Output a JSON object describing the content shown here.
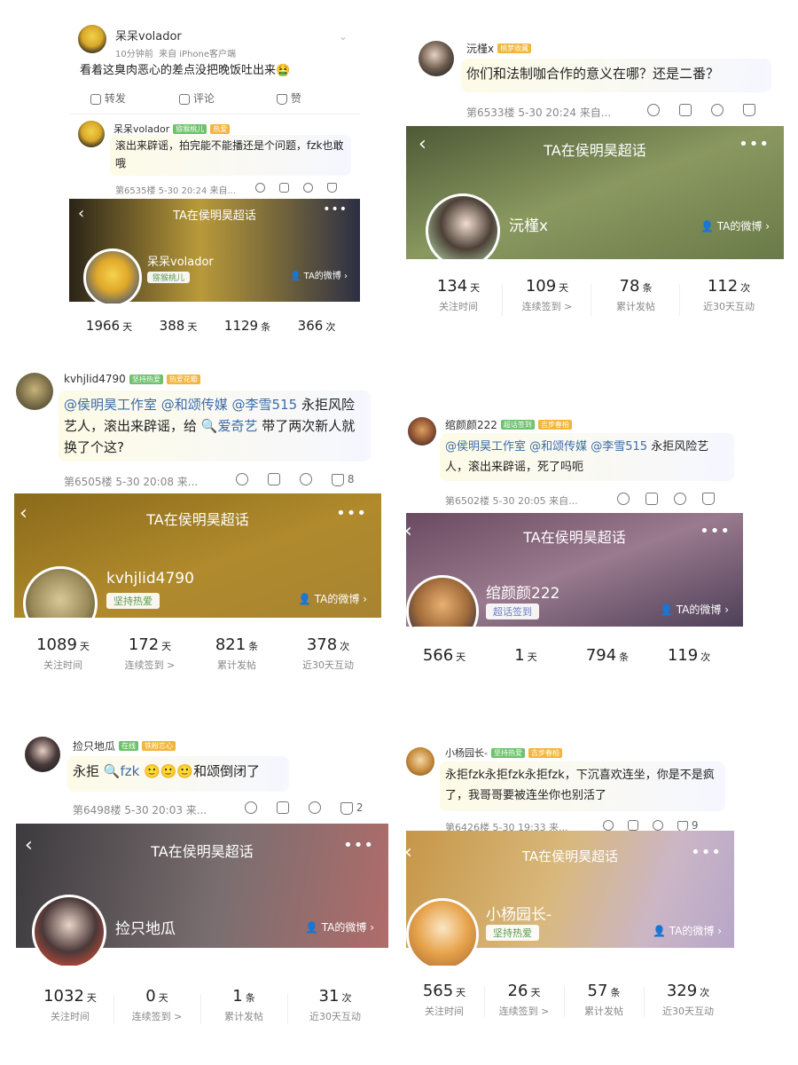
{
  "panels": [
    {
      "comment": {
        "top_post": {
          "name": "呆呆volador",
          "time": "10分钟前",
          "source": "来自 iPhone客户端",
          "text": "看着这臭肉恶心的差点没把晚饭吐出来🤮",
          "actions": [
            "转发",
            "评论",
            "赞"
          ]
        },
        "name": "呆呆volador",
        "badges": [
          "猕猴桃儿",
          "热爱"
        ],
        "text": "滚出来辟谣，拍完能不能播还是个问题，fzk也敢哦",
        "meta": "第6535楼 5-30 20:24 来自..."
      },
      "card": {
        "title": "TA在侯明昊超话",
        "name": "呆呆volador",
        "tag": "猕猴桃儿",
        "link": "TA的微博",
        "stats": [
          {
            "num": "1966",
            "unit": "天",
            "label": ""
          },
          {
            "num": "388",
            "unit": "天",
            "label": ""
          },
          {
            "num": "1129",
            "unit": "条",
            "label": ""
          },
          {
            "num": "366",
            "unit": "次",
            "label": ""
          }
        ]
      },
      "colors": {
        "card_top": "#4a3c1e",
        "card_mid": "#b99a3a",
        "card_right": "#2c2f44"
      }
    },
    {
      "comment": {
        "name": "沅槿x",
        "badges": [
          "桃梦收藏"
        ],
        "text": "你们和法制咖合作的意义在哪？还是二番？",
        "meta": "第6533楼 5-30 20:24 来自..."
      },
      "card": {
        "title": "TA在侯明昊超话",
        "name": "沅槿x",
        "tag": "",
        "link": "TA的微博",
        "stats": [
          {
            "num": "134",
            "unit": "天",
            "label": "关注时间"
          },
          {
            "num": "109",
            "unit": "天",
            "label": "连续签到 >"
          },
          {
            "num": "78",
            "unit": "条",
            "label": "累计发帖"
          },
          {
            "num": "112",
            "unit": "次",
            "label": "近30天互动"
          }
        ]
      },
      "colors": {
        "card_top": "#5c6e3a",
        "card_mid": "#8a9860",
        "card_right": "#6a7a48"
      }
    },
    {
      "comment": {
        "name": "kvhjlid4790",
        "badges": [
          "坚持热爱",
          "热爱花瓣"
        ],
        "text_parts": [
          {
            "t": "@侯明昊工作室 @和颂传媒 @李雪515",
            "m": true
          },
          {
            "t": " 永拒风险艺人，滚出来辟谣，给 ",
            "m": false
          },
          {
            "t": "🔍爱奇艺",
            "m": true
          },
          {
            "t": " 带了两次新人就换了个这?",
            "m": false
          }
        ],
        "meta": "第6505楼 5-30 20:08 来...",
        "likes": "8"
      },
      "card": {
        "title": "TA在侯明昊超话",
        "name": "kvhjlid4790",
        "tag": "坚持热爱",
        "link": "TA的微博",
        "stats": [
          {
            "num": "1089",
            "unit": "天",
            "label": "关注时间"
          },
          {
            "num": "172",
            "unit": "天",
            "label": "连续签到 >"
          },
          {
            "num": "821",
            "unit": "条",
            "label": "累计发帖"
          },
          {
            "num": "378",
            "unit": "次",
            "label": "近30天互动"
          }
        ]
      },
      "colors": {
        "card_top": "#8a6a1a",
        "card_mid": "#b08a2c",
        "card_right": "#a88432"
      }
    },
    {
      "comment": {
        "name": "绾颜颜222",
        "badges": [
          "超话签到",
          "吉步春柏"
        ],
        "text_parts": [
          {
            "t": "@侯明昊工作室 @和颂传媒 @李雪515",
            "m": true
          },
          {
            "t": " 永拒风险艺人，滚出来辟谣，死了吗呃",
            "m": false
          }
        ],
        "meta": "第6502楼 5-30 20:05 来自..."
      },
      "card": {
        "title": "TA在侯明昊超话",
        "name": "绾颜颜222",
        "tag": "超话签到",
        "link": "TA的微博",
        "stats": [
          {
            "num": "566",
            "unit": "天",
            "label": ""
          },
          {
            "num": "1",
            "unit": "天",
            "label": ""
          },
          {
            "num": "794",
            "unit": "条",
            "label": ""
          },
          {
            "num": "119",
            "unit": "次",
            "label": ""
          }
        ]
      },
      "colors": {
        "card_top": "#6a4a60",
        "card_mid": "#9a7a8e",
        "card_right": "#4e4058"
      }
    },
    {
      "comment": {
        "name": "捡只地瓜",
        "badges": [
          "在线",
          "铁粉忘心"
        ],
        "text_parts": [
          {
            "t": "永拒 ",
            "m": false
          },
          {
            "t": "🔍fzk",
            "m": true
          },
          {
            "t": " 🙂🙂🙂和颂倒闭了",
            "m": false
          }
        ],
        "meta": "第6498楼 5-30 20:03 来...",
        "likes": "2"
      },
      "card": {
        "title": "TA在侯明昊超话",
        "name": "捡只地瓜",
        "tag": "",
        "link": "TA的微博",
        "stats": [
          {
            "num": "1032",
            "unit": "天",
            "label": "关注时间"
          },
          {
            "num": "0",
            "unit": "天",
            "label": "连续签到 >"
          },
          {
            "num": "1",
            "unit": "条",
            "label": "累计发帖"
          },
          {
            "num": "31",
            "unit": "次",
            "label": "近30天互动"
          }
        ]
      },
      "colors": {
        "card_top": "#3c3a3e",
        "card_mid": "#7a6e70",
        "card_right": "#b06c6a"
      }
    },
    {
      "comment": {
        "name": "小杨园长-",
        "badges": [
          "坚持热爱",
          "吉步春柏"
        ],
        "text_parts": [
          {
            "t": "永拒fzk永拒fzk永拒fzk，下沉喜欢连坐，你是不是疯了，我哥哥要被连坐你也别活了",
            "m": false
          }
        ],
        "meta": "第6426楼 5-30 19:33 来...",
        "likes": "9"
      },
      "card": {
        "title": "TA在侯明昊超话",
        "name": "小杨园长-",
        "tag": "坚持热爱",
        "link": "TA的微博",
        "stats": [
          {
            "num": "565",
            "unit": "天",
            "label": "关注时间"
          },
          {
            "num": "26",
            "unit": "天",
            "label": "连续签到 >"
          },
          {
            "num": "57",
            "unit": "条",
            "label": "累计发帖"
          },
          {
            "num": "329",
            "unit": "次",
            "label": "近30天互动"
          }
        ]
      },
      "colors": {
        "card_top": "#c69648",
        "card_mid": "#d9b87c",
        "card_right": "#b7a6c8"
      }
    }
  ]
}
